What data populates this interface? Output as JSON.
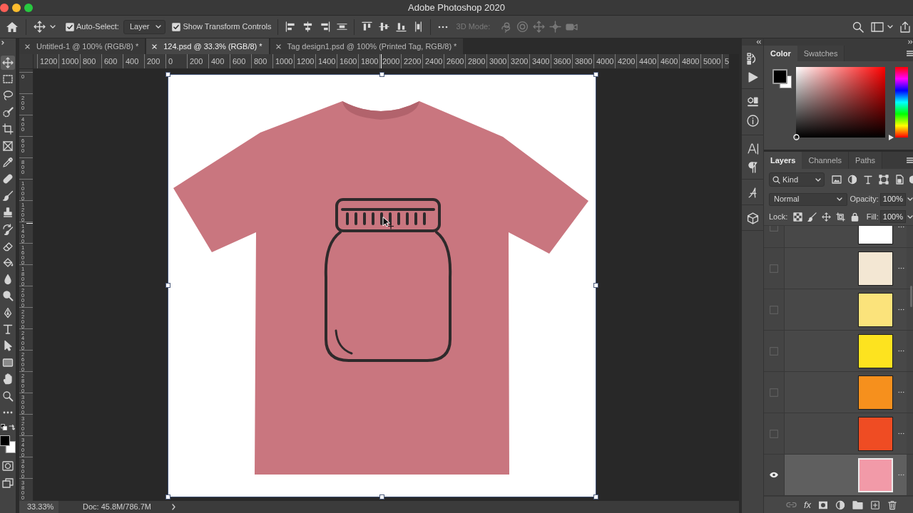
{
  "window": {
    "title": "Adobe Photoshop 2020"
  },
  "options_bar": {
    "auto_select": {
      "label": "Auto-Select:",
      "checked": true
    },
    "auto_select_target": {
      "value": "Layer"
    },
    "transform_controls": {
      "label": "Show Transform Controls",
      "checked": true
    },
    "mode_3d": {
      "label": "3D Mode:",
      "disabled": true
    }
  },
  "document_tabs": [
    {
      "label": "Untitled-1 @ 100% (RGB/8) *",
      "selected": false
    },
    {
      "label": "124.psd @ 33.3% (RGB/8) *",
      "selected": true
    },
    {
      "label": "Tag design1.psd @ 100% (Printed Tag, RGB/8) *",
      "selected": false
    }
  ],
  "rulers": {
    "horizontal": [
      "1200",
      "1000",
      "800",
      "600",
      "400",
      "200",
      "0",
      "200",
      "400",
      "600",
      "800",
      "1000",
      "1200",
      "1400",
      "1600",
      "1800",
      "2000",
      "2200",
      "2400",
      "2600",
      "2800",
      "3000",
      "3200",
      "3400",
      "3600",
      "3800",
      "4000",
      "4200",
      "4400",
      "4600",
      "4800",
      "5000",
      "5"
    ],
    "vertical": [
      "0",
      "200",
      "400",
      "600",
      "800",
      "1000",
      "1200",
      "1400",
      "1600",
      "1800",
      "2000",
      "2200",
      "2400",
      "2600",
      "2800",
      "3000",
      "3200",
      "3400",
      "3600",
      "3800"
    ]
  },
  "tools": [
    {
      "kind": "move",
      "selected": true
    },
    {
      "kind": "marquee",
      "selected": false
    },
    {
      "kind": "lasso",
      "selected": false
    },
    {
      "kind": "quick_select",
      "selected": false
    },
    {
      "kind": "crop",
      "selected": false
    },
    {
      "kind": "frame",
      "selected": false
    },
    {
      "kind": "eyedropper",
      "selected": false
    },
    {
      "kind": "healing",
      "selected": false
    },
    {
      "kind": "brush",
      "selected": false
    },
    {
      "kind": "stamp",
      "selected": false
    },
    {
      "kind": "history_brush",
      "selected": false
    },
    {
      "kind": "eraser",
      "selected": false
    },
    {
      "kind": "bucket",
      "selected": false
    },
    {
      "kind": "blur",
      "selected": false
    },
    {
      "kind": "dodge",
      "selected": false
    },
    {
      "kind": "pen",
      "selected": false
    },
    {
      "kind": "type",
      "selected": false
    },
    {
      "kind": "path_select",
      "selected": false
    },
    {
      "kind": "shape",
      "selected": false
    },
    {
      "kind": "hand",
      "selected": false
    },
    {
      "kind": "zoom",
      "selected": false
    },
    {
      "kind": "more",
      "selected": false
    }
  ],
  "status_bar": {
    "zoom": "33.33%",
    "doc_info": "Doc: 45.8M/786.7M"
  },
  "color_panel": {
    "tabs": [
      {
        "label": "Color",
        "selected": true
      },
      {
        "label": "Swatches",
        "selected": false
      }
    ],
    "hue_slider": {
      "level": 0
    }
  },
  "layers_panel": {
    "tabs": [
      {
        "label": "Layers",
        "selected": true
      },
      {
        "label": "Channels",
        "selected": false
      },
      {
        "label": "Paths",
        "selected": false
      }
    ],
    "filter": {
      "value": "Kind"
    },
    "blend_mode": {
      "value": "Normal"
    },
    "opacity": {
      "label": "Opacity:",
      "value": "100%"
    },
    "lock": {
      "label": "Lock:"
    },
    "fill": {
      "label": "Fill:",
      "value": "100%"
    },
    "layers": [
      {
        "visible": false,
        "selected": false,
        "color": "#ffffff"
      },
      {
        "visible": false,
        "selected": false,
        "color": "#f3e7d3"
      },
      {
        "visible": false,
        "selected": false,
        "color": "#fbe37b"
      },
      {
        "visible": false,
        "selected": false,
        "color": "#fde31f"
      },
      {
        "visible": false,
        "selected": false,
        "color": "#f6901d"
      },
      {
        "visible": false,
        "selected": false,
        "color": "#ef4c23"
      },
      {
        "visible": true,
        "selected": true,
        "color": "#f29aa8"
      }
    ],
    "effects_button": "fx"
  }
}
